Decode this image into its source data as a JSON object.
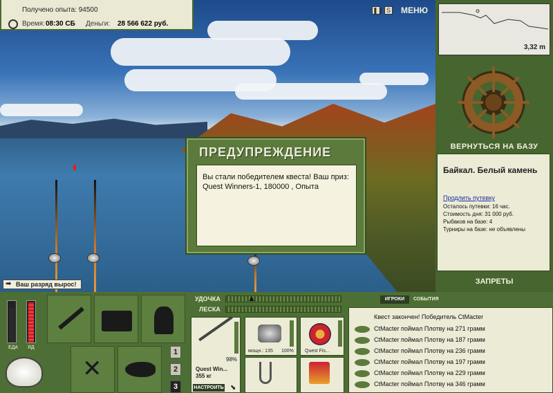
{
  "header": {
    "exp_label": "Получено опыта: 94500",
    "time_label": "Время:",
    "time_value": "08:30 СБ",
    "money_label": "Деньги:",
    "money_value": "28 566 622 руб."
  },
  "controls": {
    "pause_icon": "pause-icon",
    "sound_label": "S",
    "menu_label": "МЕНЮ"
  },
  "depth": {
    "value": "3,32 m"
  },
  "right_panel": {
    "return_label": "ВЕРНУТЬСЯ НА БАЗУ",
    "base_name": "Байкал. Белый камень",
    "extend_link": "Продлить путевку",
    "remaining": "Осталось путевки: 16 час.",
    "day_cost": "Стоимость дня: 31 000 руб.",
    "anglers": "Рыбаков на базе: 4",
    "tournaments": "Турниры на базе: не объявлены",
    "bans_label": "ЗАПРЕТЫ"
  },
  "dialog": {
    "title": "ПРЕДУПРЕЖДЕНИЕ",
    "message": "Вы стали победителем квеста! Ваш приз: Quest Winners-1, 180000 , Опыта"
  },
  "rank_badge": "Ваш разряд вырос!",
  "status": {
    "food_label": "ЕДА",
    "poison_label": "ЯД"
  },
  "tackle": {
    "rod_label": "УДОЧКА",
    "line_label": "ЛЕСКА",
    "rod_percent": "98%",
    "rod_name": "Quest Win...",
    "rod_weight": "355 кг",
    "setup_label": "НАСТРОИТЬ",
    "reel_power": "мощн.: 135",
    "reel_percent": "100%",
    "line_name": "Quest Fis...",
    "slot_numbers": [
      "1",
      "2",
      "3"
    ]
  },
  "players_panel": {
    "tab_players": "ИГРОКИ",
    "tab_events": "СОБЫТИЯ",
    "log": [
      "Квест закончен! Победитель CtMacter",
      "CtMacter поймал Плотву на 271 грамм",
      "CtMacter поймал Плотву на 187 грамм",
      "CtMacter поймал Плотву на 236 грамм",
      "CtMacter поймал Плотву на 197 грамм",
      "CtMacter поймал Плотву на 229 грамм",
      "CtMacter поймал Плотву на 346 грамм"
    ]
  },
  "colors": {
    "panel_green": "#4d6e34",
    "panel_light": "#ecebd6",
    "title_text": "#e9eadb"
  }
}
